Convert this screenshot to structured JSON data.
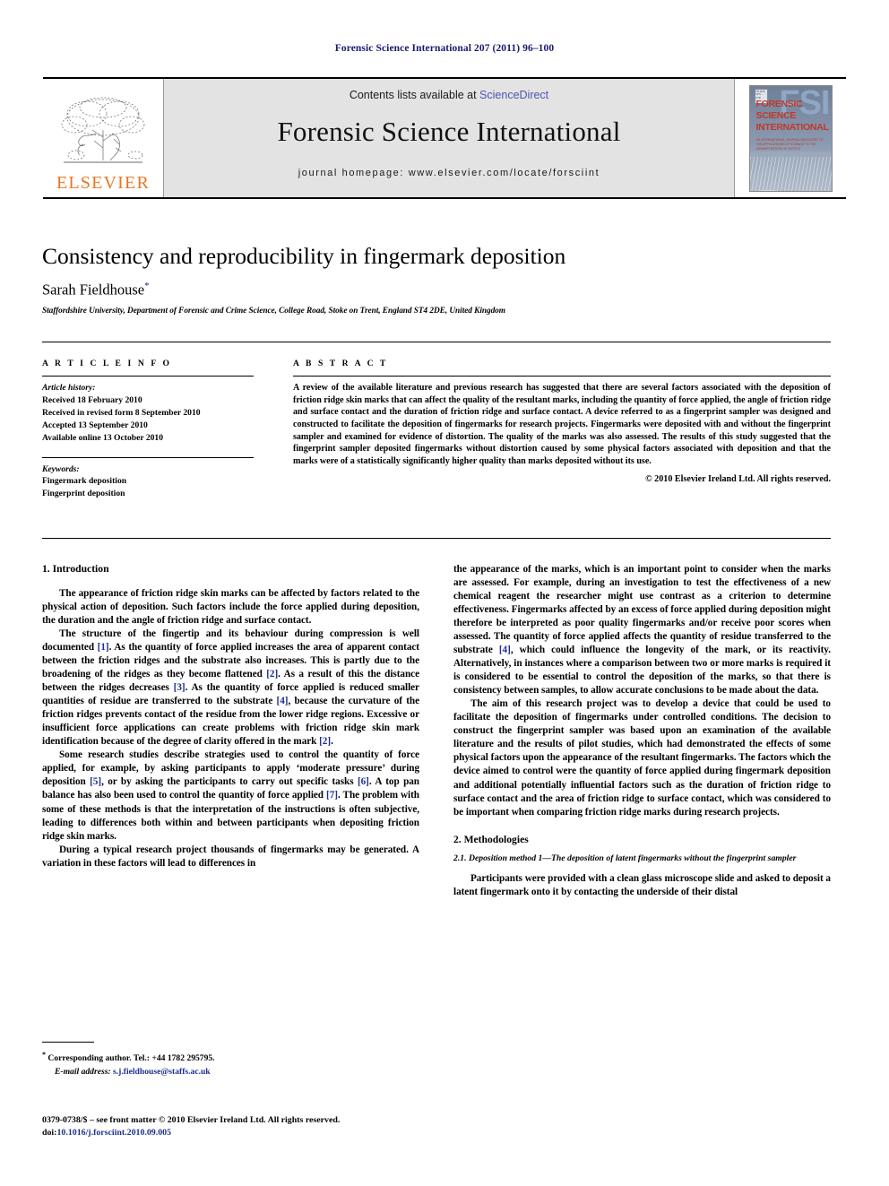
{
  "running_head": "Forensic Science International 207 (2011) 96–100",
  "masthead": {
    "publisher_name": "ELSEVIER",
    "publisher_logo_alt": "elsevier-tree-logo",
    "contents_prefix": "Contents lists available at ",
    "contents_link": "ScienceDirect",
    "journal_name": "Forensic Science International",
    "homepage": "journal homepage: www.elsevier.com/locate/forsciint",
    "cover": {
      "title_line1": "FORENSIC",
      "title_line2": "SCIENCE",
      "title_line3": "INTERNATIONAL",
      "mark": "FSI",
      "subtitle": "AN INTERNATIONAL JOURNAL DEDICATED TO THE APPLICATIONS OF SCIENCE TO THE ADMINISTRATION OF JUSTICE",
      "badge": "FSI ISSN 0379-0738"
    },
    "link_color": "#4a55b5",
    "band_color": "#e3e3e3",
    "elsevier_orange": "#E87722"
  },
  "article": {
    "title": "Consistency and reproducibility in fingermark deposition",
    "author": "Sarah Fieldhouse",
    "author_marker": "*",
    "affiliation": "Staffordshire University, Department of Forensic and Crime Science, College Road, Stoke on Trent, England ST4 2DE, United Kingdom"
  },
  "article_info": {
    "label": "A R T I C L E   I N F O",
    "history_label": "Article history:",
    "history": [
      "Received 18 February 2010",
      "Received in revised form 8 September 2010",
      "Accepted 13 September 2010",
      "Available online 13 October 2010"
    ],
    "keywords_label": "Keywords:",
    "keywords": [
      "Fingermark deposition",
      "Fingerprint deposition"
    ]
  },
  "abstract": {
    "label": "A B S T R A C T",
    "text": "A review of the available literature and previous research has suggested that there are several factors associated with the deposition of friction ridge skin marks that can affect the quality of the resultant marks, including the quantity of force applied, the angle of friction ridge and surface contact and the duration of friction ridge and surface contact. A device referred to as a fingerprint sampler was designed and constructed to facilitate the deposition of fingermarks for research projects. Fingermarks were deposited with and without the fingerprint sampler and examined for evidence of distortion. The quality of the marks was also assessed. The results of this study suggested that the fingerprint sampler deposited fingermarks without distortion caused by some physical factors associated with deposition and that the marks were of a statistically significantly higher quality than marks deposited without its use.",
    "copyright": "© 2010 Elsevier Ireland Ltd. All rights reserved."
  },
  "body": {
    "section1_heading": "1. Introduction",
    "left_paragraphs": [
      "The appearance of friction ridge skin marks can be affected by factors related to the physical action of deposition. Such factors include the force applied during deposition, the duration and the angle of friction ridge and surface contact.",
      "The structure of the fingertip and its behaviour during compression is well documented [1]. As the quantity of force applied increases the area of apparent contact between the friction ridges and the substrate also increases. This is partly due to the broadening of the ridges as they become flattened [2]. As a result of this the distance between the ridges decreases [3]. As the quantity of force applied is reduced smaller quantities of residue are transferred to the substrate [4], because the curvature of the friction ridges prevents contact of the residue from the lower ridge regions. Excessive or insufficient force applications can create problems with friction ridge skin mark identification because of the degree of clarity offered in the mark [2].",
      "Some research studies describe strategies used to control the quantity of force applied, for example, by asking participants to apply ‘moderate pressure’ during deposition [5], or by asking the participants to carry out specific tasks [6]. A top pan balance has also been used to control the quantity of force applied [7]. The problem with some of these methods is that the interpretation of the instructions is often subjective, leading to differences both within and between participants when depositing friction ridge skin marks.",
      "During a typical research project thousands of fingermarks may be generated. A variation in these factors will lead to differences in"
    ],
    "right_paragraphs": [
      "the appearance of the marks, which is an important point to consider when the marks are assessed. For example, during an investigation to test the effectiveness of a new chemical reagent the researcher might use contrast as a criterion to determine effectiveness. Fingermarks affected by an excess of force applied during deposition might therefore be interpreted as poor quality fingermarks and/or receive poor scores when assessed. The quantity of force applied affects the quantity of residue transferred to the substrate [4], which could influence the longevity of the mark, or its reactivity. Alternatively, in instances where a comparison between two or more marks is required it is considered to be essential to control the deposition of the marks, so that there is consistency between samples, to allow accurate conclusions to be made about the data.",
      "The aim of this research project was to develop a device that could be used to facilitate the deposition of fingermarks under controlled conditions. The decision to construct the fingerprint sampler was based upon an examination of the available literature and the results of pilot studies, which had demonstrated the effects of some physical factors upon the appearance of the resultant fingermarks. The factors which the device aimed to control were the quantity of force applied during fingermark deposition and additional potentially influential factors such as the duration of friction ridge to surface contact and the area of friction ridge to surface contact, which was considered to be important when comparing friction ridge marks during research projects."
    ],
    "section2_heading": "2. Methodologies",
    "subsection21_heading": "2.1. Deposition method 1—The deposition of latent fingermarks without the fingerprint sampler",
    "subsection21_paragraph": "Participants were provided with a clean glass microscope slide and asked to deposit a latent fingermark onto it by contacting the underside of their distal"
  },
  "footnote": {
    "marker": "*",
    "corresponding": "Corresponding author. Tel.: +44 1782 295795.",
    "email_label": "E-mail address:",
    "email": "s.j.fieldhouse@staffs.ac.uk"
  },
  "imprint": {
    "line1": "0379-0738/$ – see front matter © 2010 Elsevier Ireland Ltd. All rights reserved.",
    "doi_prefix": "doi:",
    "doi": "10.1016/j.forsciint.2010.09.005"
  },
  "colors": {
    "running_head": "#1a1a6e",
    "reference_link": "#1a2f8f",
    "science_direct": "#4a55b5",
    "elsevier_orange": "#E87722"
  }
}
